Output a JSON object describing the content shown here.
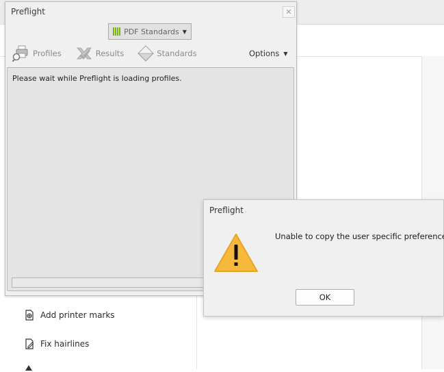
{
  "background": {
    "tools": [
      {
        "label": "Add printer marks",
        "icon": "printer-marks-icon"
      },
      {
        "label": "Fix hairlines",
        "icon": "fix-hairlines-icon"
      }
    ]
  },
  "preflight_panel": {
    "title": "Preflight",
    "close_icon": "close-icon",
    "dropdown_label": "PDF Standards",
    "tabs": [
      {
        "label": "Profiles",
        "icon": "profiles-icon"
      },
      {
        "label": "Results",
        "icon": "results-icon"
      },
      {
        "label": "Standards",
        "icon": "standards-icon"
      }
    ],
    "options_label": "Options",
    "status_message": "Please wait while Preflight is loading profiles."
  },
  "alert_dialog": {
    "title": "Preflight",
    "message": "Unable to copy the user specific preferences:",
    "ok_label": "OK",
    "icon": "warning-icon"
  },
  "colors": {
    "accent_green": "#7ab317",
    "warning_yellow": "#f7b93c"
  }
}
